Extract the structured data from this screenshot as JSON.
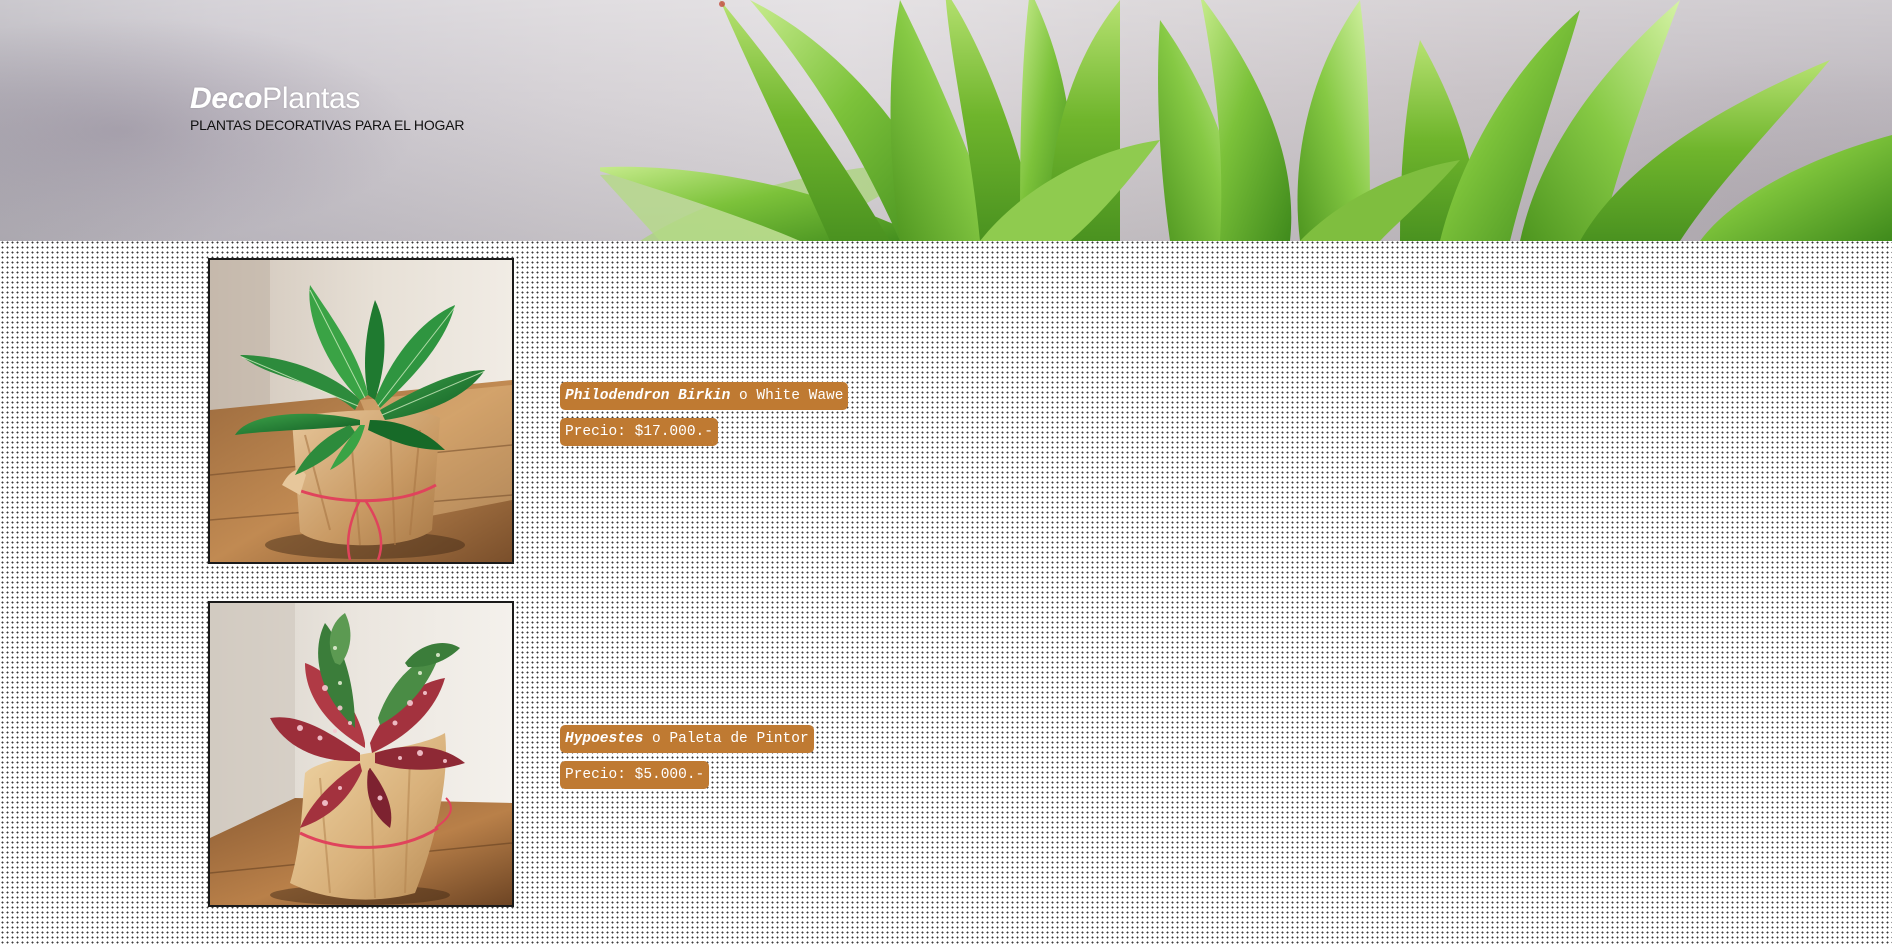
{
  "header": {
    "brand_part1": "Deco",
    "brand_part2": "Plantas",
    "tagline": "PLANTAS DECORATIVAS PARA EL HOGAR"
  },
  "products": [
    {
      "scientific_name": "Philodendron Birkin",
      "common_name_connector": " o White Wawe",
      "price": "Precio: $17.000.-"
    },
    {
      "scientific_name": "Hypoestes",
      "common_name_connector": " o Paleta de Pintor",
      "price": "Precio: $5.000.-"
    }
  ],
  "colors": {
    "tag_background": "#bf7a32",
    "tag_text": "#ffffff",
    "frame_border": "#1a1a1a"
  }
}
